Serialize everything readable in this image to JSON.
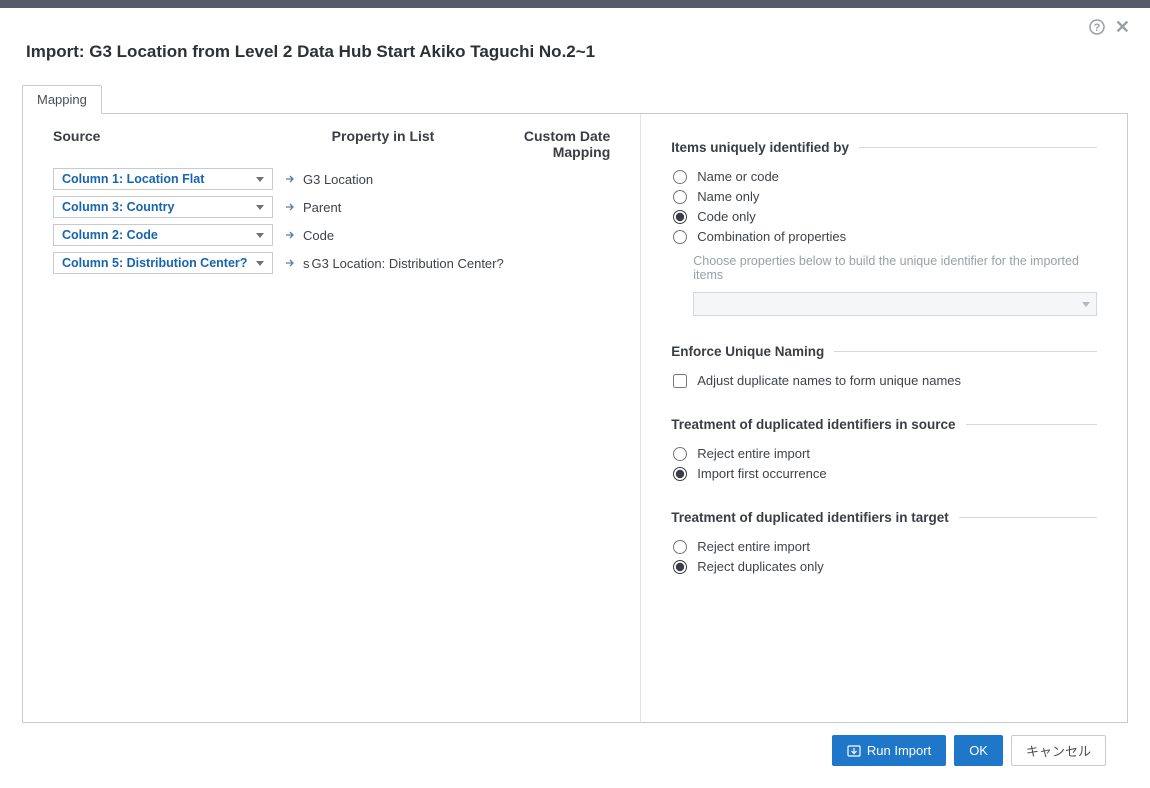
{
  "title": "Import: G3 Location from Level 2 Data Hub Start Akiko Taguchi No.2~1",
  "tabs": {
    "mapping": "Mapping"
  },
  "headers": {
    "source": "Source",
    "property": "Property in List",
    "custom": "Custom Date Mapping"
  },
  "rows": [
    {
      "source": "Column 1: Location Flat",
      "prefix": "",
      "property": "G3 Location"
    },
    {
      "source": "Column 3: Country",
      "prefix": "",
      "property": "Parent"
    },
    {
      "source": "Column 2: Code",
      "prefix": "",
      "property": "Code"
    },
    {
      "source": "Column 5: Distribution Center?",
      "prefix": "s",
      "property": "G3 Location: Distribution Center?"
    }
  ],
  "identity": {
    "section": "Items uniquely identified by",
    "options": {
      "name_or_code": "Name or code",
      "name_only": "Name only",
      "code_only": "Code only",
      "combo": "Combination of properties"
    },
    "selected": "code_only",
    "hint": "Choose properties below to build the unique identifier for the imported items"
  },
  "enforce": {
    "section": "Enforce Unique Naming",
    "adjust_label": "Adjust duplicate names to form unique names",
    "adjust_checked": false
  },
  "dup_source": {
    "section": "Treatment of duplicated identifiers in source",
    "options": {
      "reject": "Reject entire import",
      "first": "Import first occurrence"
    },
    "selected": "first"
  },
  "dup_target": {
    "section": "Treatment of duplicated identifiers in target",
    "options": {
      "reject": "Reject entire import",
      "dupes": "Reject duplicates only"
    },
    "selected": "dupes"
  },
  "buttons": {
    "run_import": "Run Import",
    "ok": "OK",
    "cancel": "キャンセル"
  }
}
